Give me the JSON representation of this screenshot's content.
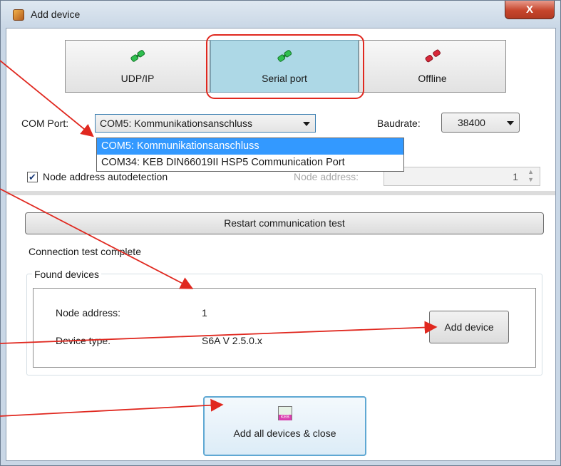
{
  "window": {
    "title": "Add device",
    "close_glyph": "X"
  },
  "modes": [
    {
      "label": "UDP/IP",
      "icon": "green-plug-icon",
      "selected": false
    },
    {
      "label": "Serial port",
      "icon": "green-plug-icon",
      "selected": true
    },
    {
      "label": "Offline",
      "icon": "red-plug-icon",
      "selected": false
    }
  ],
  "com_port": {
    "label": "COM Port:",
    "value": "COM5: Kommunikationsanschluss",
    "options": [
      "COM5: Kommunikationsanschluss",
      "COM34: KEB DIN66019II HSP5 Communication Port"
    ],
    "selected_index": 0
  },
  "baudrate": {
    "label": "Baudrate:",
    "value": "38400"
  },
  "autodetect": {
    "label": "Node address autodetection",
    "checked": true
  },
  "node_address": {
    "label": "Node address:",
    "value": "1"
  },
  "restart_button": "Restart communication test",
  "status_text": "Connection test complete",
  "found_devices": {
    "legend": "Found devices",
    "node_address_label": "Node address:",
    "node_address_value": "1",
    "device_type_label": "Device type:",
    "device_type_value": "S6A V 2.5.0.x",
    "add_button": "Add device"
  },
  "add_all_button": {
    "label": "Add all devices & close",
    "icon_text": "KEB"
  },
  "colors": {
    "selected_tile": "#add8e6",
    "highlight": "#3399ff",
    "annotation": "#e0281f",
    "plug_green": "#2fbf4f",
    "plug_red": "#d8283a"
  }
}
